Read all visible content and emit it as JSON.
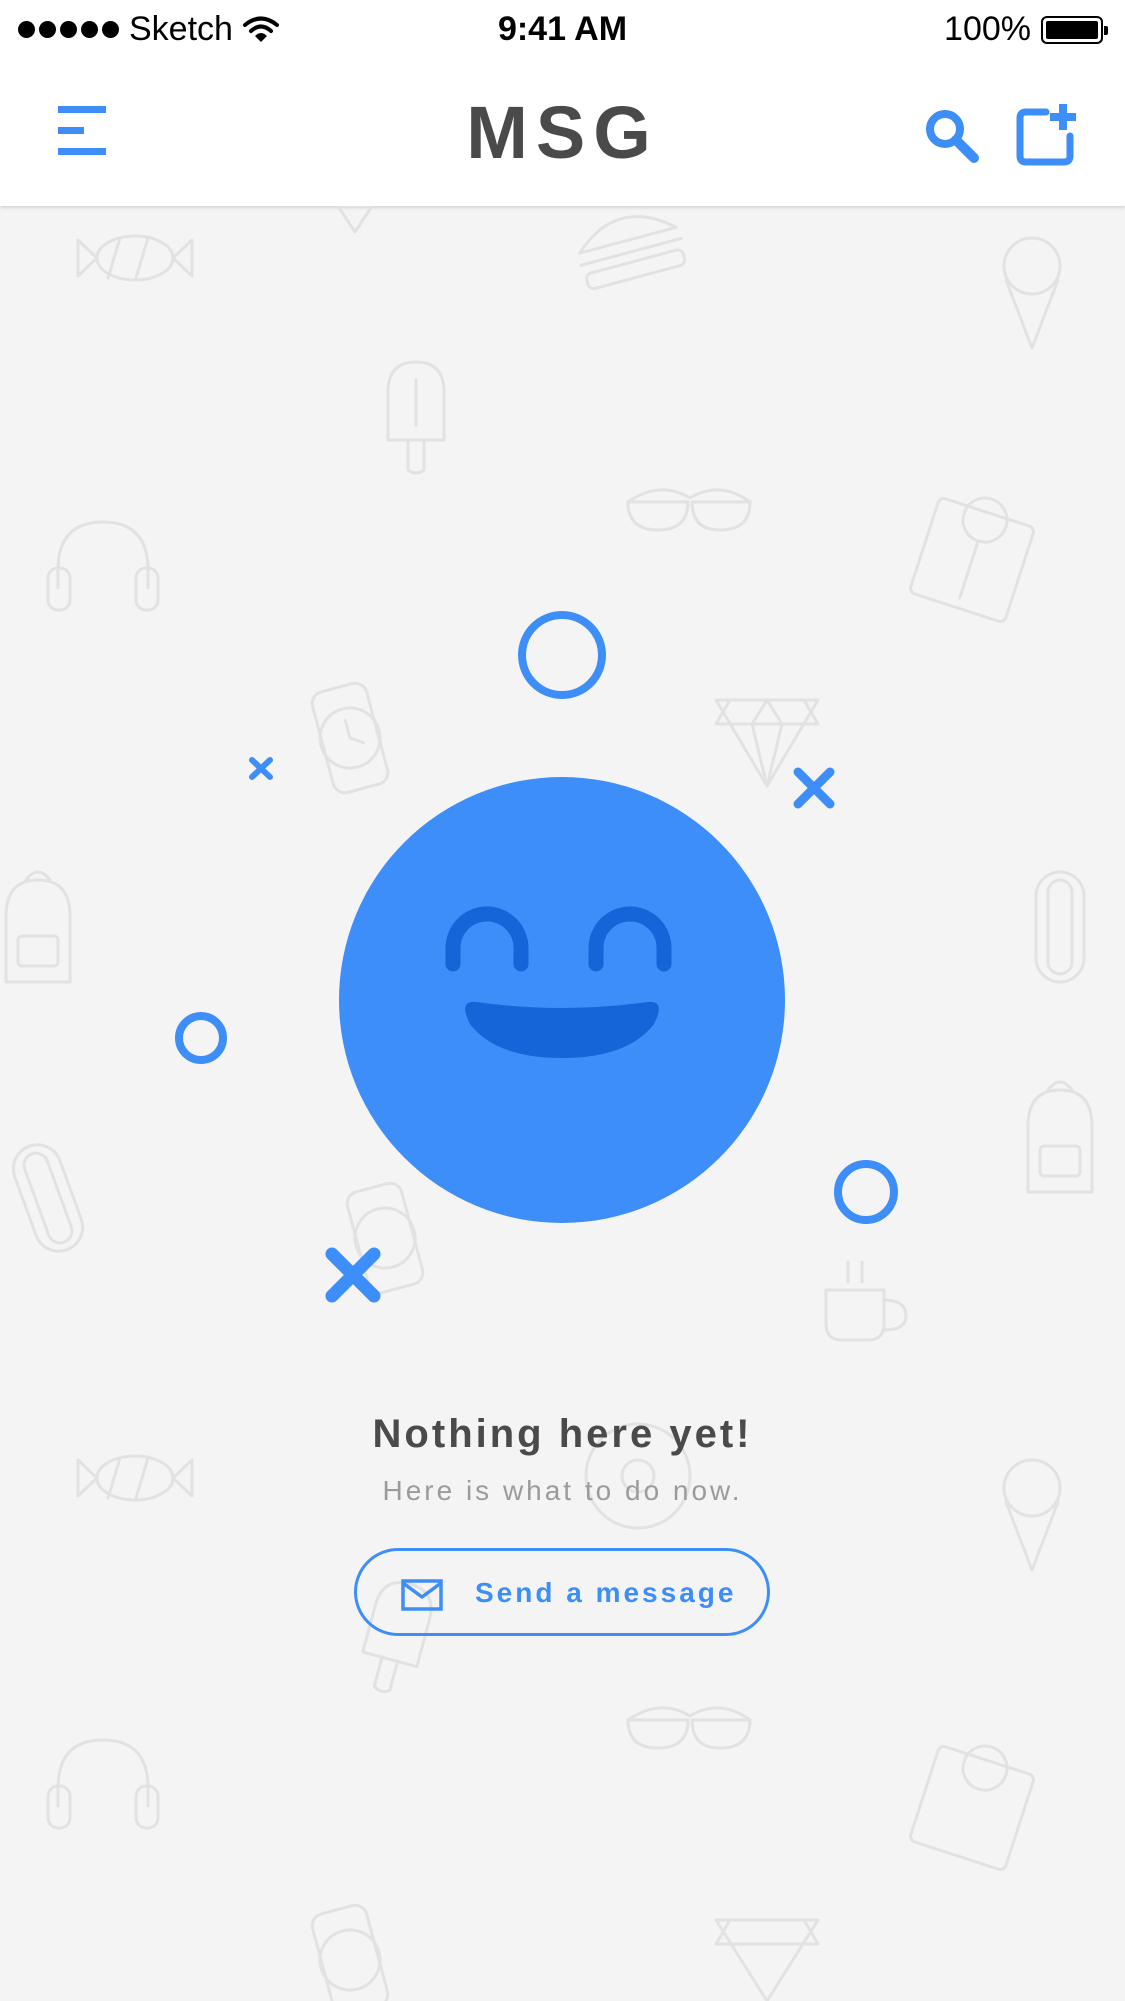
{
  "status_bar": {
    "carrier": "Sketch",
    "time": "9:41 AM",
    "battery": "100%"
  },
  "header": {
    "title": "MSG",
    "icons": [
      "menu-icon",
      "search-icon",
      "compose-icon"
    ]
  },
  "empty_state": {
    "title": "Nothing here yet!",
    "subtitle": "Here is what to do now.",
    "button_label": "Send a message",
    "button_icon": "mail-icon"
  },
  "colors": {
    "accent": "#3d8ef8",
    "smiley_face": "#3d8ef8",
    "smiley_features": "#1565d8",
    "title_text": "#4a4a4a",
    "subtitle_text": "#9b9b9b",
    "background": "#f4f4f4",
    "pattern_lines": "#e2e2e2"
  }
}
